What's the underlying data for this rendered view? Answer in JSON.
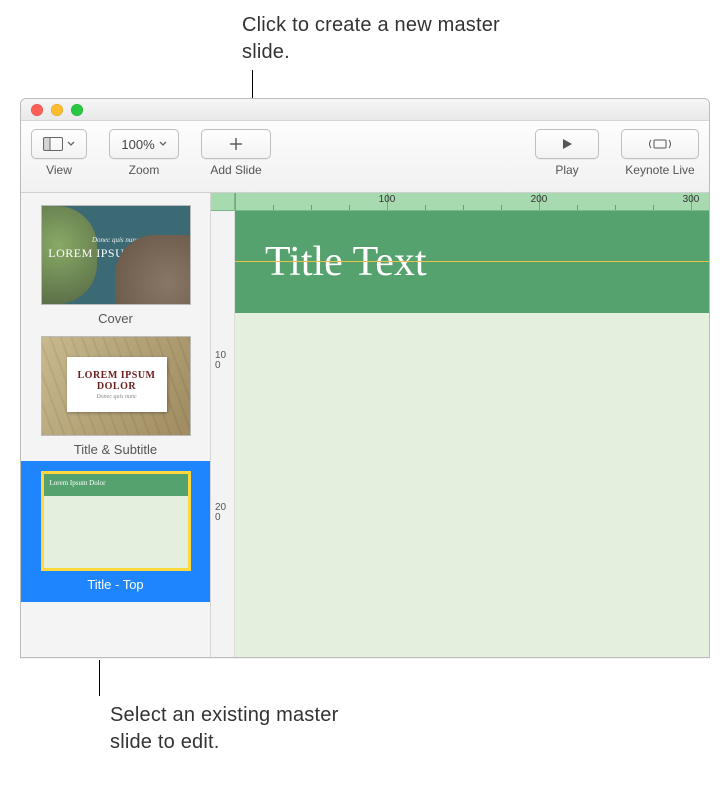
{
  "callouts": {
    "top": "Click to create a new master slide.",
    "bottom": "Select an existing master slide to edit."
  },
  "toolbar": {
    "view": {
      "label": "View"
    },
    "zoom": {
      "label": "Zoom",
      "value": "100%"
    },
    "add_slide": {
      "label": "Add Slide"
    },
    "play": {
      "label": "Play"
    },
    "keynote_live": {
      "label": "Keynote Live"
    }
  },
  "ruler": {
    "h_ticks": [
      "100",
      "200",
      "300"
    ],
    "v_ticks": [
      "100",
      "200"
    ]
  },
  "canvas": {
    "title_text": "Title Text"
  },
  "sidebar": {
    "items": [
      {
        "label": "Cover",
        "selected": false,
        "content": {
          "small": "Donec quis nunc",
          "big": "LOREM IPSUM DOLOR"
        }
      },
      {
        "label": "Title & Subtitle",
        "selected": false,
        "content": {
          "t1": "LOREM IPSUM DOLOR",
          "t2": "Donec quis nunc"
        }
      },
      {
        "label": "Title - Top",
        "selected": true,
        "content": {
          "bar": "Lorem Ipsum Dolor"
        }
      }
    ]
  }
}
